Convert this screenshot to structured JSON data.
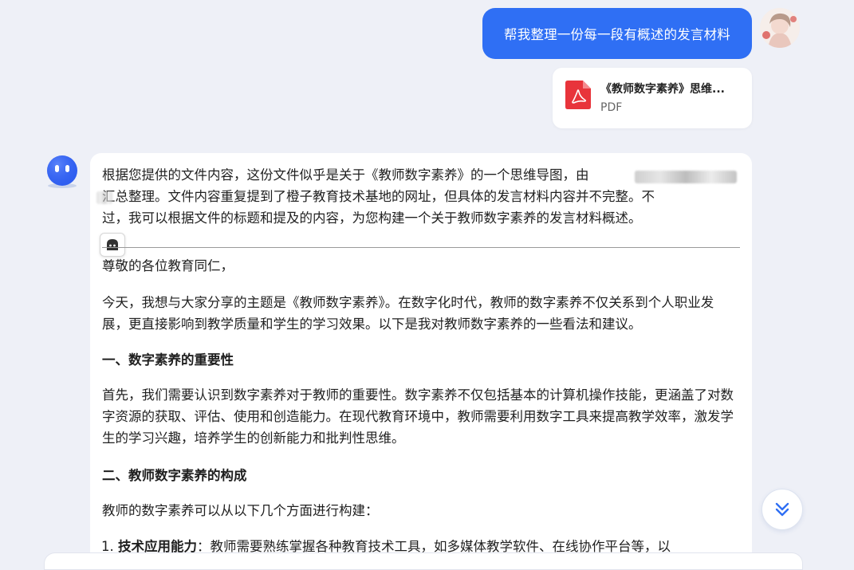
{
  "user_message": {
    "text": "帮我整理一份每一段有概述的发言材料"
  },
  "attachment": {
    "name": "《教师数字素养》思维...",
    "type": "PDF"
  },
  "answer": {
    "intro_line1": "根据您提供的文件内容，这份文件似乎是关于《教师数字素养》的一个思维导图，由",
    "intro_line2": "汇总整理。文件内容重复提到了橙子教育技术基地的网址，但具体的发言材料内容并不完整。不",
    "intro_line3": "过，我可以根据文件的标题和提及的内容，为您构建一个关于教师数字素养的发言材料概述。",
    "greeting": "尊敬的各位教育同仁，",
    "opening": "今天，我想与大家分享的主题是《教师数字素养》。在数字化时代，教师的数字素养不仅关系到个人职业发展，更直接影响到教学质量和学生的学习效果。以下是我对教师数字素养的一些看法和建议。",
    "section1_title": "一、数字素养的重要性",
    "section1_body": "首先，我们需要认识到数字素养对于教师的重要性。数字素养不仅包括基本的计算机操作技能，更涵盖了对数字资源的获取、评估、使用和创造能力。在现代教育环境中，教师需要利用数字工具来提高教学效率，激发学生的学习兴趣，培养学生的创新能力和批判性思维。",
    "section2_title": "二、教师数字素养的构成",
    "section2_intro": "教师的数字素养可以从以下几个方面进行构建：",
    "list_items": [
      {
        "bold": "技术应用能力",
        "text": "：教师需要熟练掌握各种教育技术工具，如多媒体教学软件、在线协作平台等，以"
      }
    ]
  },
  "icons": {
    "user_avatar": "user-avatar-illustration",
    "bot_avatar": "blue-robot-face",
    "pdf": "pdf-file-icon",
    "scroll_down": "double-chevron-down-icon",
    "copy": "ghost-chip-icon"
  },
  "colors": {
    "accent": "#2f6ff4",
    "background": "#eef0f7",
    "pdf_red": "#e8343b"
  }
}
